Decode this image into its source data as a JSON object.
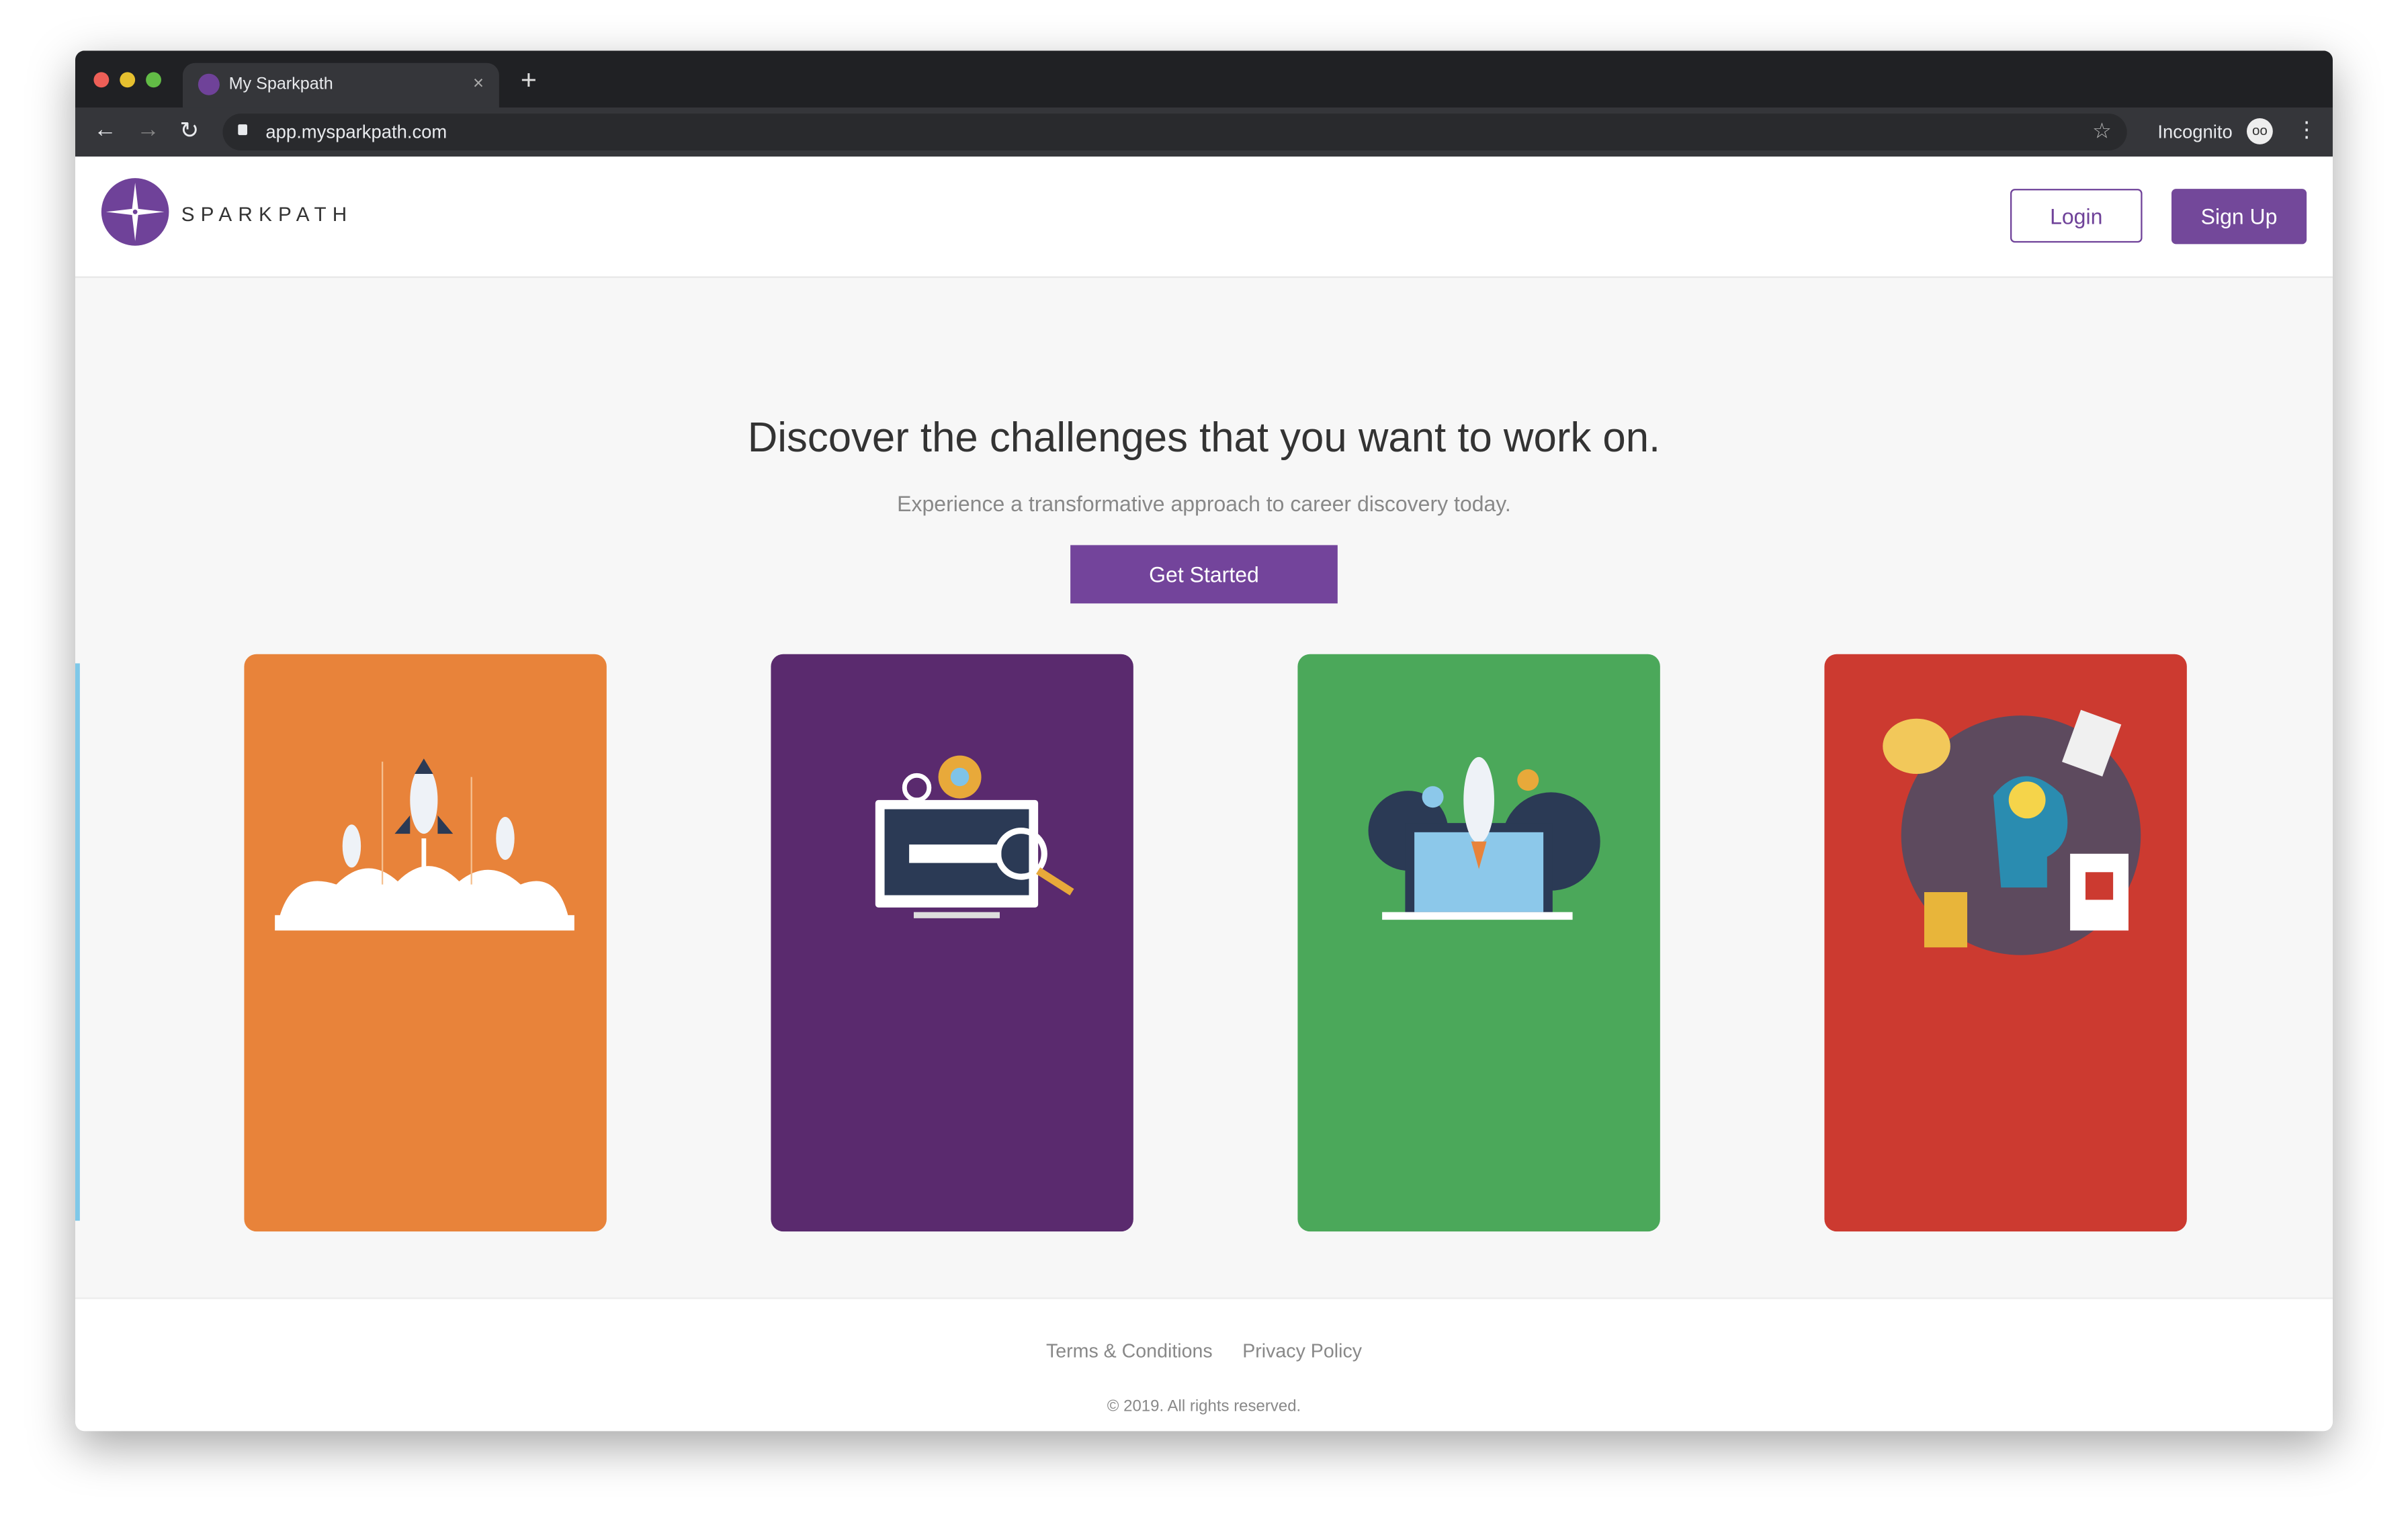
{
  "browser": {
    "tab_title": "My Sparkpath",
    "tab_close": "×",
    "new_tab": "+",
    "url": "app.mysparkpath.com",
    "profile_label": "Incognito"
  },
  "header": {
    "brand": "SPARKPATH",
    "login_label": "Login",
    "signup_label": "Sign Up"
  },
  "hero": {
    "title": "Discover the challenges that you want to work on.",
    "subtitle": "Experience a transformative approach to career discovery today.",
    "cta_label": "Get Started"
  },
  "cards": [
    {
      "illustration": "rockets-launch",
      "color": "#e8833a"
    },
    {
      "illustration": "monitor-search-gears",
      "color": "#5a2a6e"
    },
    {
      "illustration": "laptop-rocket",
      "color": "#4ba85a"
    },
    {
      "illustration": "creative-mind",
      "color": "#cc3a30"
    }
  ],
  "footer": {
    "links": [
      "Terms & Conditions",
      "Privacy Policy"
    ],
    "copyright": "© 2019. All rights reserved."
  },
  "colors": {
    "brand": "#6f4299",
    "accent_button": "#73449b"
  }
}
